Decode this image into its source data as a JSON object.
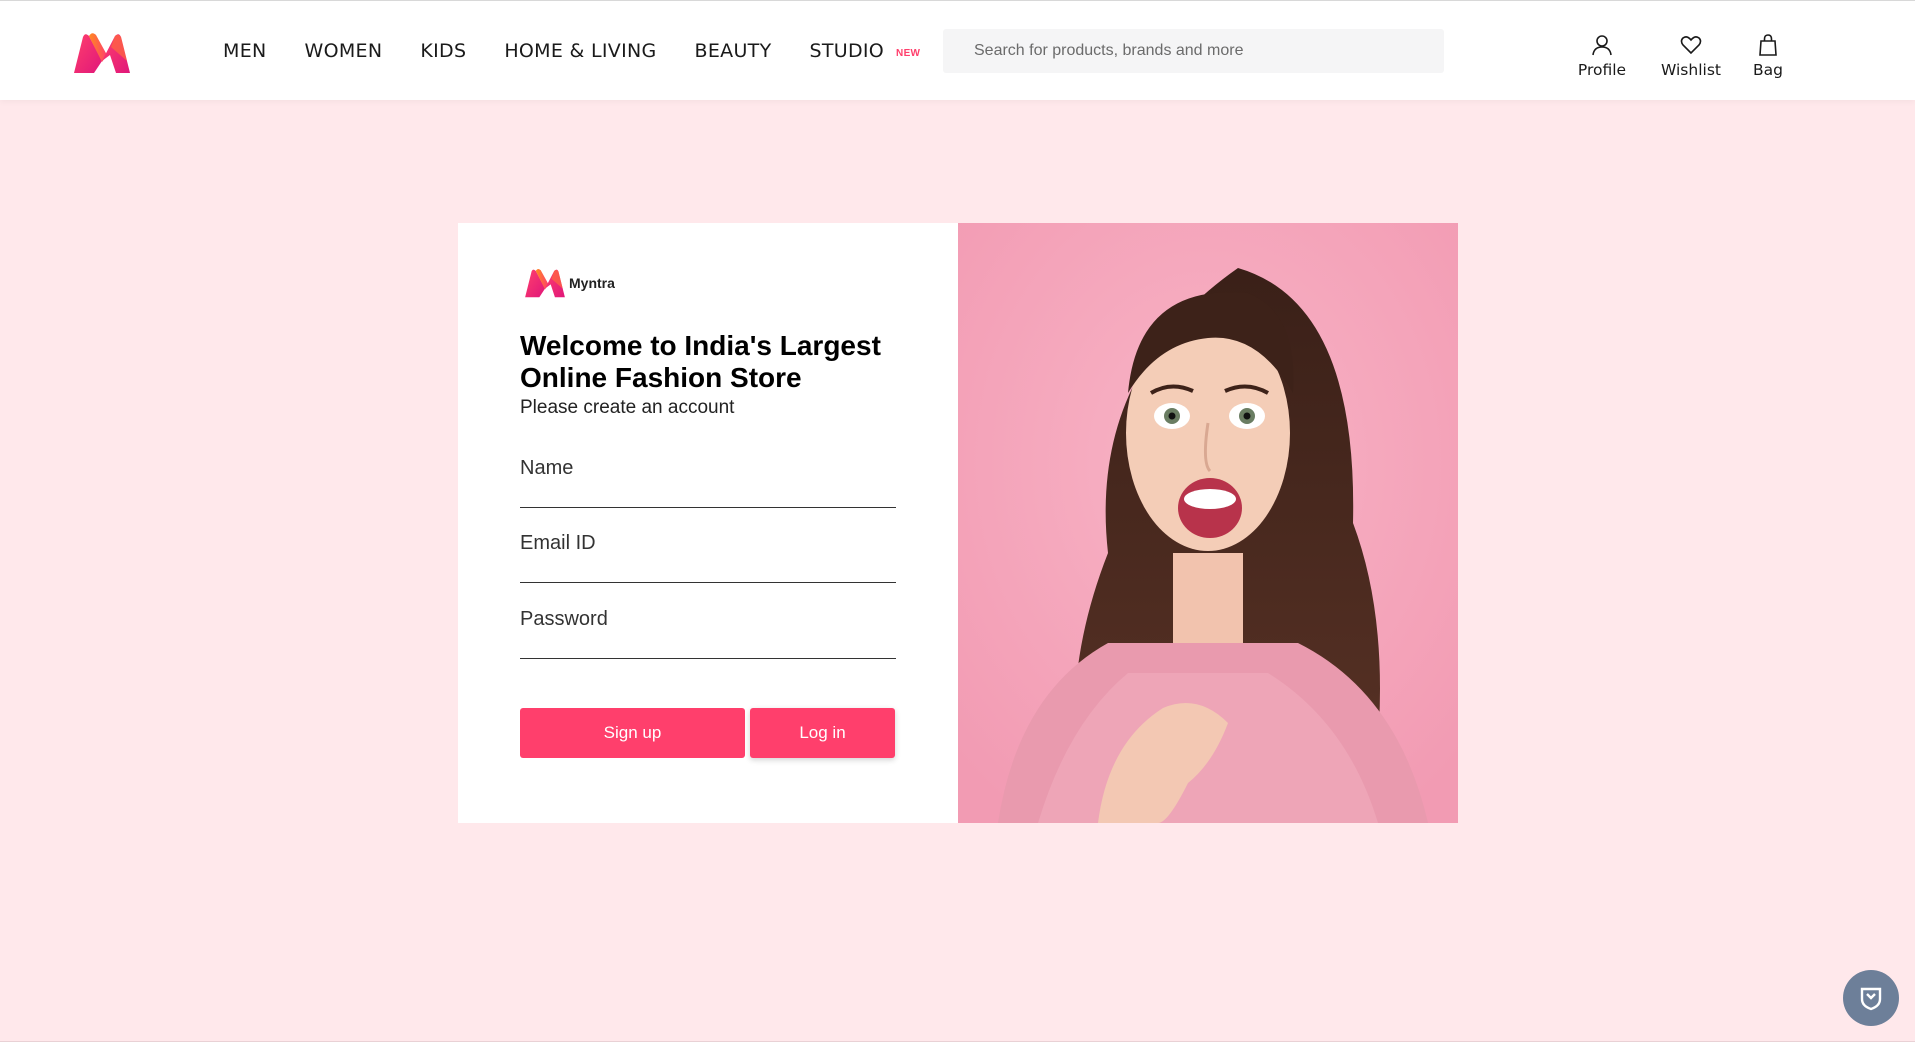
{
  "header": {
    "nav": [
      "MEN",
      "WOMEN",
      "KIDS",
      "HOME & LIVING",
      "BEAUTY",
      "STUDIO"
    ],
    "studio_badge": "NEW",
    "search_placeholder": "Search for products, brands and more",
    "actions": {
      "profile": "Profile",
      "wishlist": "Wishlist",
      "bag": "Bag"
    }
  },
  "login": {
    "brand_name": "Myntra",
    "title": "Welcome to India's Largest Online Fashion Store",
    "subtitle": "Please create an account",
    "fields": {
      "name_placeholder": "Name",
      "email_placeholder": "Email ID",
      "password_placeholder": "Password"
    },
    "signup_label": "Sign up",
    "login_label": "Log in"
  },
  "colors": {
    "accent": "#ff3f6c",
    "page_background": "#ffe8eb",
    "image_background": "#f6a7bd"
  },
  "icons": {
    "logo": "myntra-logo",
    "profile": "user-icon",
    "wishlist": "heart-icon",
    "bag": "shopping-bag-icon",
    "fab": "shield-icon"
  }
}
